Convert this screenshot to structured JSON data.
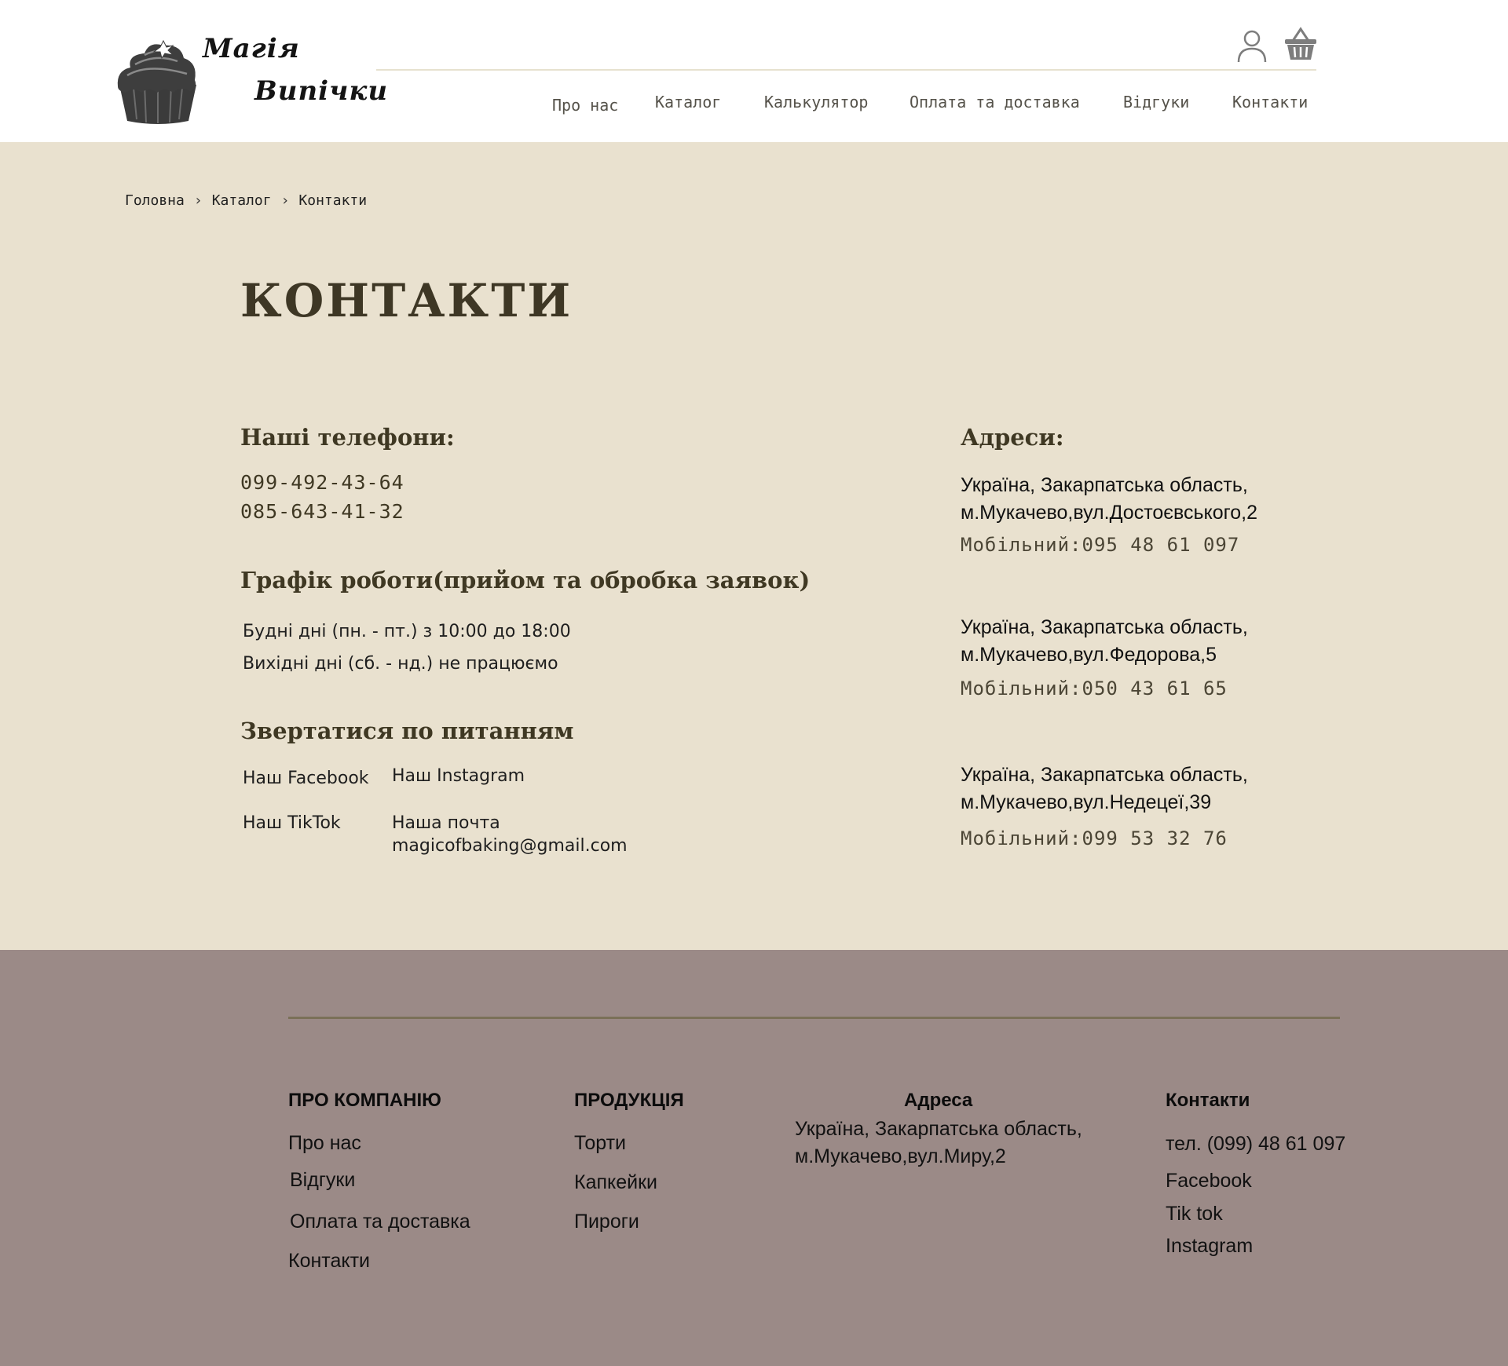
{
  "header": {
    "logo": {
      "line1": "Магія",
      "line2": "Випічки"
    },
    "nav": [
      "Про нас",
      "Каталог",
      "Калькулятор",
      "Оплата та доставка",
      "Відгуки",
      "Контакти"
    ],
    "icons": {
      "account": "user-icon",
      "cart": "basket-icon"
    }
  },
  "breadcrumb": {
    "items": [
      "Головна",
      "Каталог",
      "Контакти"
    ],
    "separator": "›"
  },
  "page": {
    "title": "КОНТАКТИ",
    "phones": {
      "heading": "Наші телефони:",
      "numbers": [
        "099-492-43-64",
        "085-643-41-32"
      ]
    },
    "schedule": {
      "heading": "Графік роботи(прийом та обробка заявок)",
      "lines": [
        "Будні дні (пн. - пт.) з 10:00 до 18:00",
        "Вихідні дні (сб. - нд.) не працюємо"
      ]
    },
    "contact": {
      "heading": "Звертатися по питанням",
      "facebook": "Наш Facebook",
      "instagram": "Наш Instagram",
      "tiktok": "Наш TikTok",
      "mail_label": "Наша почта",
      "email": "magicofbaking@gmail.com"
    },
    "addresses": {
      "heading": "Адреси:",
      "items": [
        {
          "line1": "Україна, Закарпатська область,",
          "line2": "м.Мукачево,вул.Достоєвського,2",
          "mobile": "Мобільний:095 48 61 097"
        },
        {
          "line1": "Україна, Закарпатська область,",
          "line2": "м.Мукачево,вул.Федорова,5",
          "mobile": "Мобільний:050 43 61 65"
        },
        {
          "line1": "Україна, Закарпатська область,",
          "line2": "м.Мукачево,вул.Недецеї,39",
          "mobile": "Мобільний:099 53 32 76"
        }
      ]
    }
  },
  "footer": {
    "company": {
      "heading": "ПРО КОМПАНІЮ",
      "links": [
        "Про нас",
        "Відгуки",
        "Оплата та доставка",
        "Контакти"
      ]
    },
    "products": {
      "heading": "ПРОДУКЦІЯ",
      "links": [
        "Торти",
        "Капкейки",
        "Пироги"
      ]
    },
    "address": {
      "heading": "Адреса",
      "line1": "Україна, Закарпатська область,",
      "line2": "м.Мукачево,вул.Миру,2"
    },
    "contacts": {
      "heading": "Контакти",
      "phone": "тел. (099) 48 61 097",
      "links": [
        "Facebook",
        "Tik tok",
        "Instagram"
      ]
    }
  },
  "colors": {
    "header_bg": "#ffffff",
    "main_bg": "#e9e1cf",
    "footer_bg": "#9b8a87",
    "heading": "#3f3823",
    "footer_rule": "#7b7058"
  }
}
